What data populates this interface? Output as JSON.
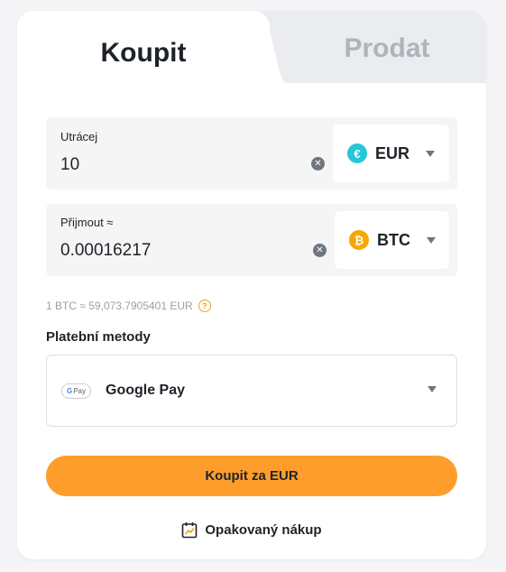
{
  "tabs": {
    "buy": "Koupit",
    "sell": "Prodat"
  },
  "spend": {
    "label": "Utrácej",
    "value": "10",
    "currency": "EUR",
    "currency_icon": "euro-icon",
    "icon_color": "#26c6da",
    "icon_glyph": "€"
  },
  "receive": {
    "label": "Přijmout ≈",
    "value": "0.00016217",
    "currency": "BTC",
    "currency_icon": "bitcoin-icon",
    "icon_color": "#f7a600",
    "icon_glyph": "₿"
  },
  "rate": {
    "text": "1 BTC ≈ 59,073.7905401 EUR",
    "help_glyph": "?"
  },
  "payment": {
    "title": "Platební metody",
    "method": "Google Pay",
    "logo_g": "G",
    "logo_text": "Pay"
  },
  "buy_button": {
    "label": "Koupit za EUR",
    "color": "#fe9d2b"
  },
  "recurring": {
    "label": "Opakovaný nákup"
  },
  "clear_glyph": "✕"
}
